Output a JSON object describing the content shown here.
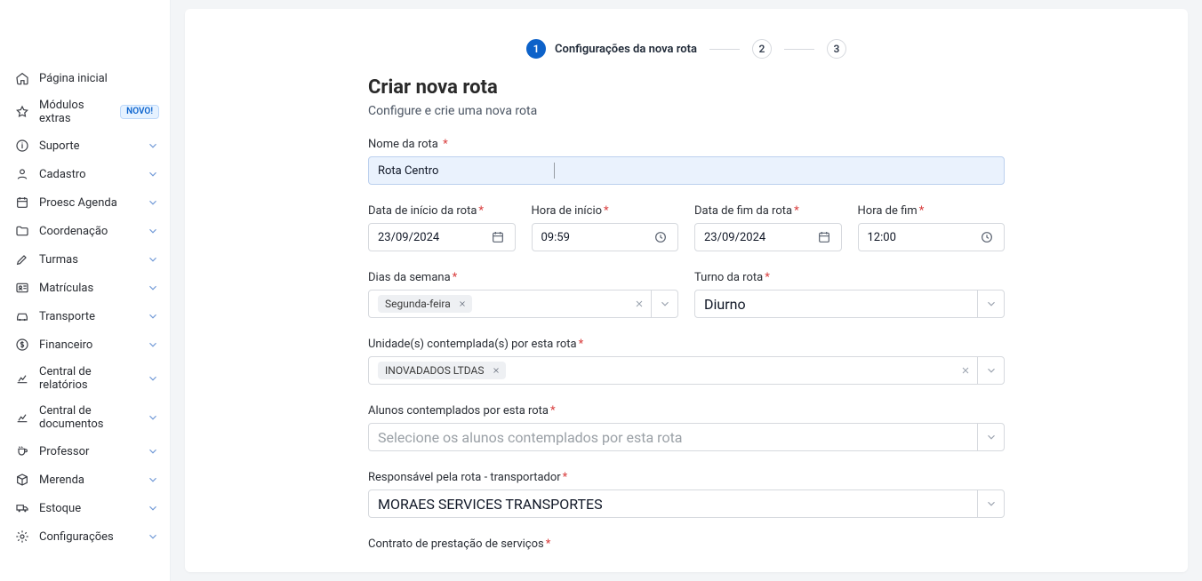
{
  "sidebar": {
    "items": [
      {
        "label": "Página inicial",
        "icon": "home-icon",
        "caret": false
      },
      {
        "label": "Módulos extras",
        "icon": "star-icon",
        "badge": "NOVO!",
        "caret": false
      },
      {
        "label": "Suporte",
        "icon": "info-icon",
        "caret": true
      },
      {
        "label": "Cadastro",
        "icon": "user-icon",
        "caret": true
      },
      {
        "label": "Proesc Agenda",
        "icon": "calendar-icon",
        "caret": true
      },
      {
        "label": "Coordenação",
        "icon": "folder-icon",
        "caret": true
      },
      {
        "label": "Turmas",
        "icon": "pencil-icon",
        "caret": true
      },
      {
        "label": "Matrículas",
        "icon": "id-icon",
        "caret": true
      },
      {
        "label": "Transporte",
        "icon": "car-icon",
        "caret": true
      },
      {
        "label": "Financeiro",
        "icon": "money-icon",
        "caret": true
      },
      {
        "label": "Central de relatórios",
        "icon": "chart-icon",
        "caret": true
      },
      {
        "label": "Central de documentos",
        "icon": "chart-icon",
        "caret": true
      },
      {
        "label": "Professor",
        "icon": "cup-icon",
        "caret": true
      },
      {
        "label": "Merenda",
        "icon": "box-icon",
        "caret": true
      },
      {
        "label": "Estoque",
        "icon": "truck-icon",
        "caret": true
      },
      {
        "label": "Configurações",
        "icon": "gear-icon",
        "caret": true
      }
    ]
  },
  "stepper": {
    "steps": [
      {
        "num": "1",
        "label": "Configurações da nova rota",
        "active": true
      },
      {
        "num": "2",
        "label": "",
        "active": false
      },
      {
        "num": "3",
        "label": "",
        "active": false
      }
    ]
  },
  "page": {
    "title": "Criar nova rota",
    "subtitle": "Configure e crie uma nova rota"
  },
  "form": {
    "route_name_label": "Nome da rota",
    "route_name_value": "Rota Centro",
    "start_date_label": "Data de início da rota",
    "start_date_value": "23/09/2024",
    "start_time_label": "Hora de início",
    "start_time_value": "09:59",
    "end_date_label": "Data de fim da rota",
    "end_date_value": "23/09/2024",
    "end_time_label": "Hora de fim",
    "end_time_value": "12:00",
    "days_label": "Dias da semana",
    "days_chips": [
      "Segunda-feira"
    ],
    "shift_label": "Turno da rota",
    "shift_value": "Diurno",
    "units_label": "Unidade(s) contemplada(s) por esta rota",
    "units_chips": [
      "INOVADADOS LTDAS"
    ],
    "students_label": "Alunos contemplados por esta rota",
    "students_placeholder": "Selecione os alunos contemplados por esta rota",
    "responsible_label": "Responsável pela rota - transportador",
    "responsible_value": "MORAES SERVICES TRANSPORTES",
    "contract_label": "Contrato de prestação de serviços"
  }
}
